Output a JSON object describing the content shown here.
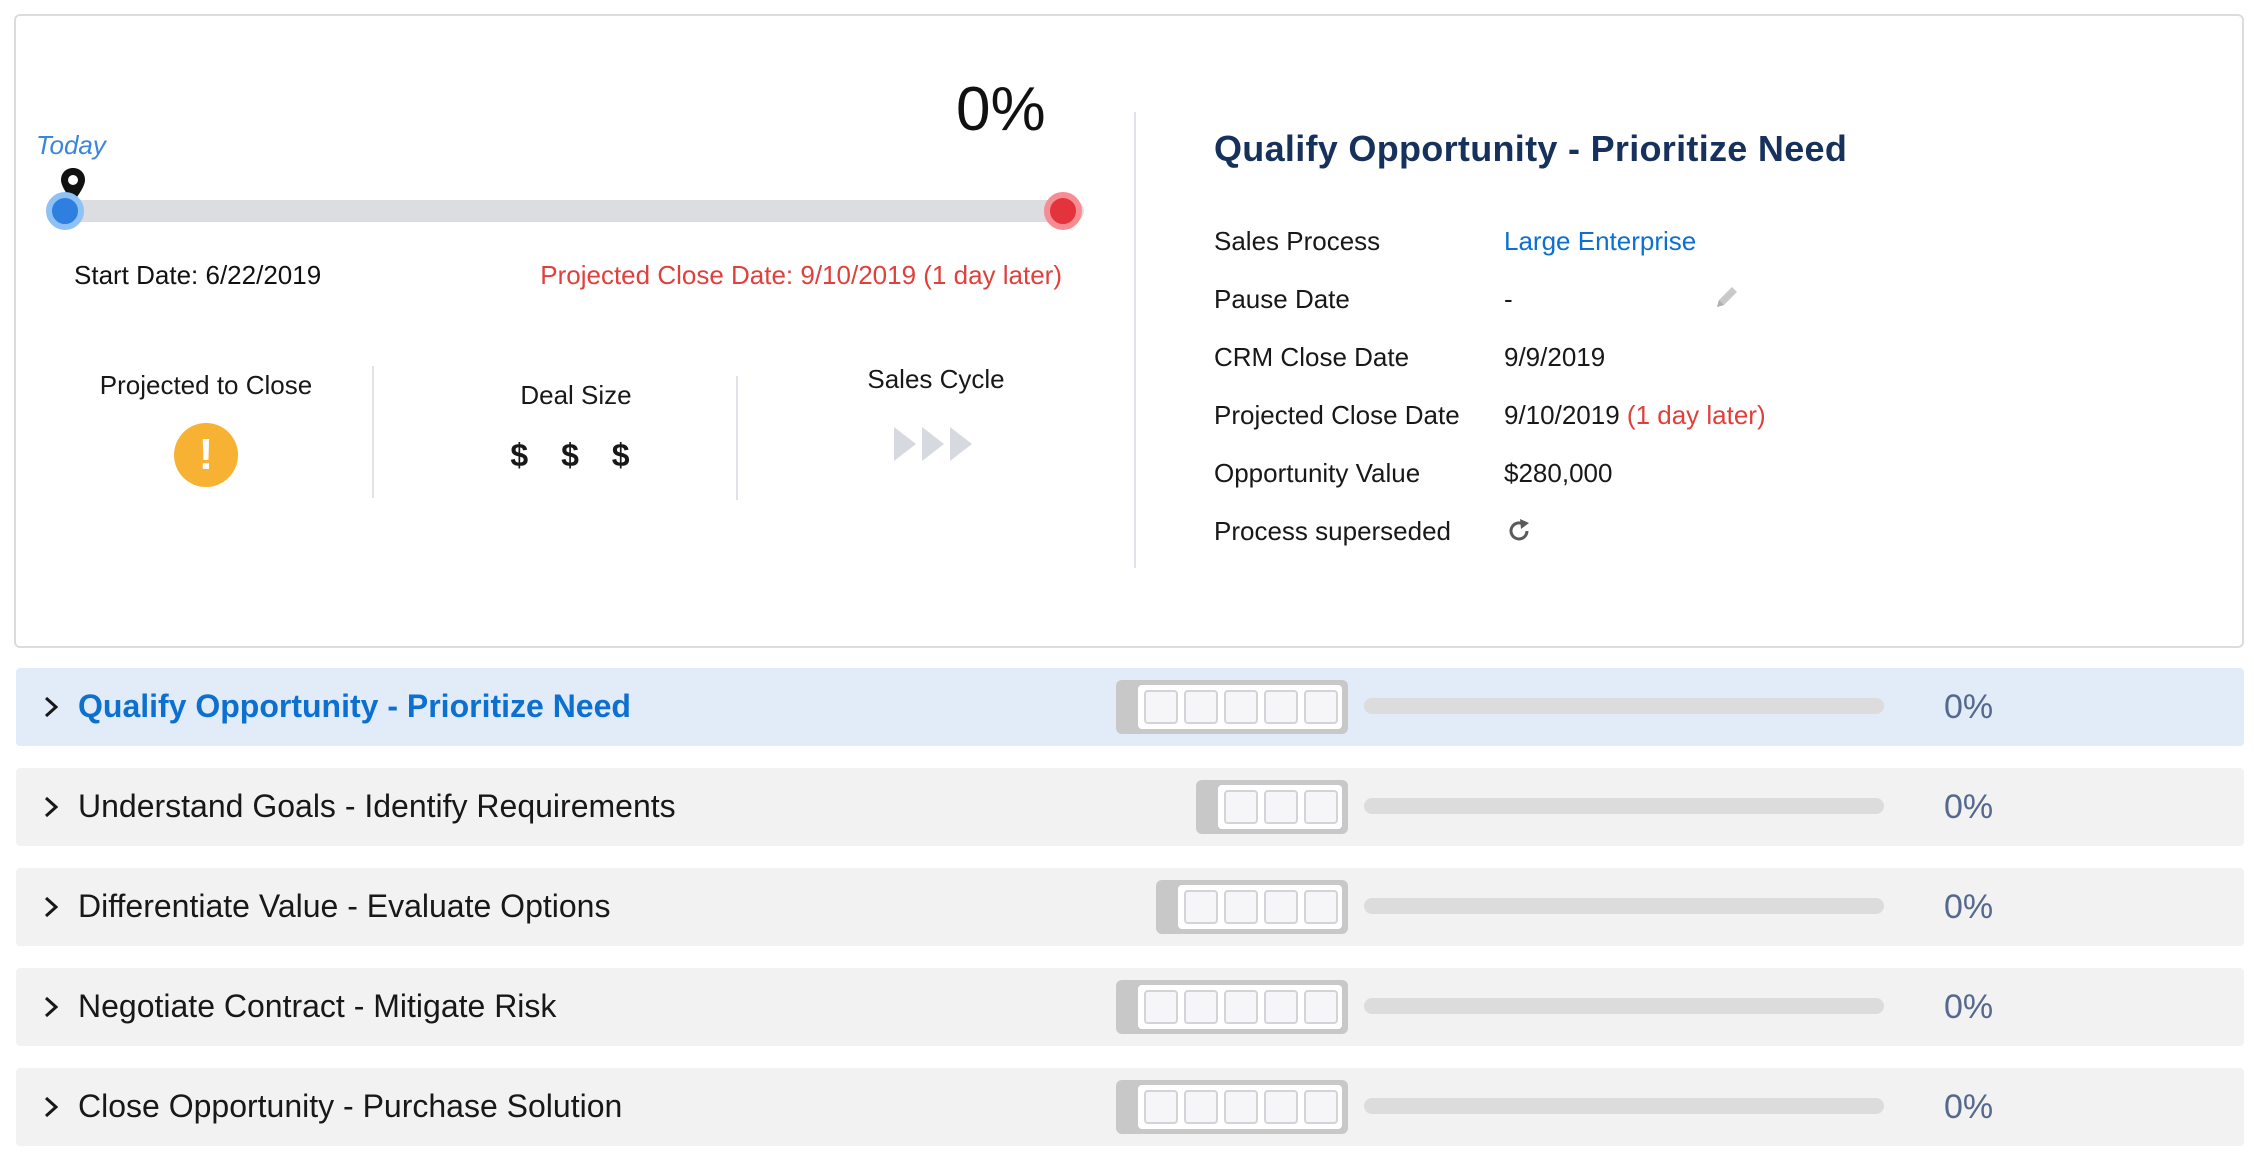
{
  "timeline": {
    "today_label": "Today",
    "progress_text": "0%",
    "start_date": "Start Date: 6/22/2019",
    "projected_close": "Projected Close Date: 9/10/2019 (1 day later)"
  },
  "metrics": {
    "projected_to_close": "Projected to Close",
    "warning_glyph": "!",
    "deal_size": "Deal Size",
    "deal_size_value": "$ $ $",
    "sales_cycle": "Sales Cycle"
  },
  "details": {
    "title": "Qualify Opportunity - Prioritize Need",
    "sales_process_label": "Sales Process",
    "sales_process_value": "Large Enterprise",
    "pause_date_label": "Pause Date",
    "pause_date_value": "-",
    "crm_close_label": "CRM Close Date",
    "crm_close_value": "9/9/2019",
    "projected_close_label": "Projected Close Date",
    "projected_close_value": "9/10/2019",
    "projected_close_note": "(1 day later)",
    "opp_value_label": "Opportunity Value",
    "opp_value_value": "$280,000",
    "superseded_label": "Process superseded"
  },
  "stages": [
    {
      "label": "Qualify Opportunity - Prioritize Need",
      "percent": "0%",
      "steps": 5,
      "active": true
    },
    {
      "label": "Understand Goals - Identify Requirements",
      "percent": "0%",
      "steps": 3,
      "active": false
    },
    {
      "label": "Differentiate Value - Evaluate Options",
      "percent": "0%",
      "steps": 4,
      "active": false
    },
    {
      "label": "Negotiate Contract - Mitigate Risk",
      "percent": "0%",
      "steps": 5,
      "active": false
    },
    {
      "label": "Close Opportunity - Purchase Solution",
      "percent": "0%",
      "steps": 5,
      "active": false
    }
  ],
  "colors": {
    "accent": "#0c70d0",
    "warning": "#f7b233",
    "late": "#e0403c",
    "title": "#16325c"
  }
}
